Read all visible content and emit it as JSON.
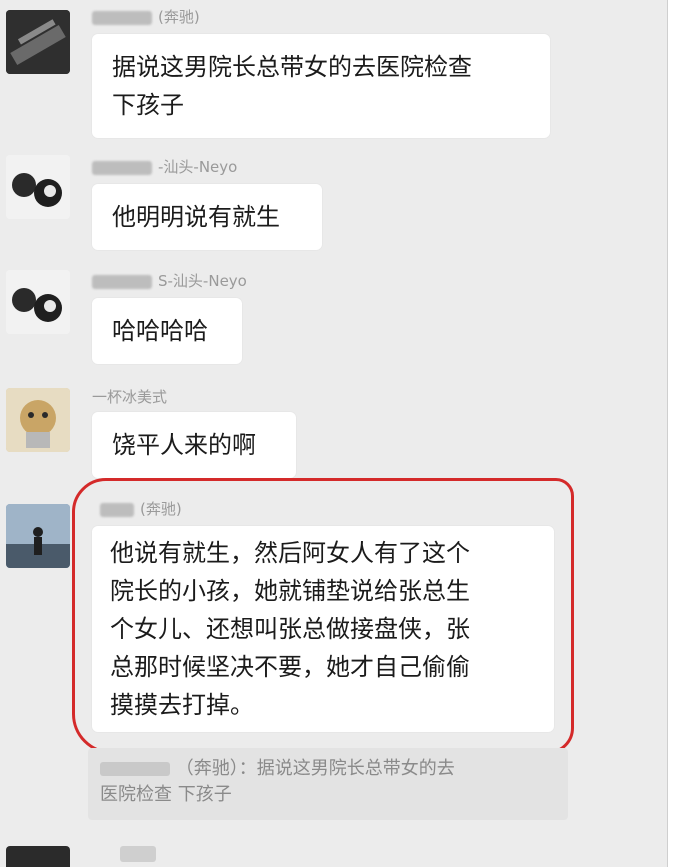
{
  "messages": [
    {
      "sender": "(奔驰)",
      "text_lines": [
        "据说这男院长总带女的去医院检查",
        "下孩子"
      ]
    },
    {
      "sender": "-汕头-Neyo",
      "text_lines": [
        "他明明说有就生"
      ]
    },
    {
      "sender": "S-汕头-Neyo",
      "text_lines": [
        "哈哈哈哈"
      ]
    },
    {
      "sender": "一杯冰美式",
      "text_lines": [
        "饶平人来的啊"
      ]
    },
    {
      "sender": "(奔驰)",
      "text_lines": [
        "他说有就生，然后阿女人有了这个",
        "院长的小孩，她就铺垫说给张总生",
        "个女儿、还想叫张总做接盘侠，张",
        "总那时候坚决不要，她才自己偷偷",
        "摸摸去打掉。"
      ]
    }
  ],
  "quote": {
    "prefix": "（奔驰）：",
    "line1": "据说这男院长总带女的去",
    "line2": "医院检查 下孩子"
  },
  "colors": {
    "highlight": "#d42a2a",
    "bubble": "#ffffff",
    "background": "#ececec"
  }
}
